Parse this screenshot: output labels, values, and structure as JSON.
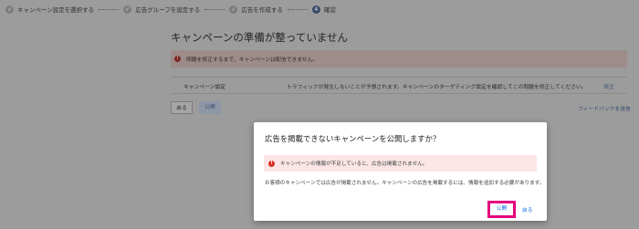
{
  "stepper": {
    "steps": [
      {
        "label": "キャンペーン設定を選択する",
        "state": "done",
        "marker": "✓"
      },
      {
        "label": "広告グループを設定する",
        "state": "done",
        "marker": "✓"
      },
      {
        "label": "広告を作成する",
        "state": "done",
        "marker": "✓"
      },
      {
        "label": "確認",
        "state": "current",
        "marker": "4"
      }
    ]
  },
  "page": {
    "title": "キャンペーンの準備が整っていません",
    "alert": {
      "icon": "error-icon",
      "text": "問題を修正するまで、キャンペーンは配信できません。"
    },
    "issue_row": {
      "section": "キャンペーン設定",
      "message": "トラフィックが発生しないことが予想されます。キャンペーンのターゲティング設定を確認してこの問題を修正してください。",
      "action": "修正"
    },
    "back_label": "戻る",
    "publish_label": "公開",
    "feedback_label": "フィードバックを送信"
  },
  "dialog": {
    "title": "広告を掲載できないキャンペーンを公開しますか？",
    "alert": {
      "icon": "error-icon",
      "text": "キャンペーンの情報が不足していると、広告は掲載されません。"
    },
    "body": "お客様のキャンペーンでは広告が掲載されません。キャンペーンの広告を掲載するには、情報を追加する必要があります。",
    "publish_label": "公開",
    "back_label": "戻る"
  },
  "colors": {
    "highlight": "#e3007f",
    "link": "#1a73e8",
    "error": "#d93025"
  }
}
